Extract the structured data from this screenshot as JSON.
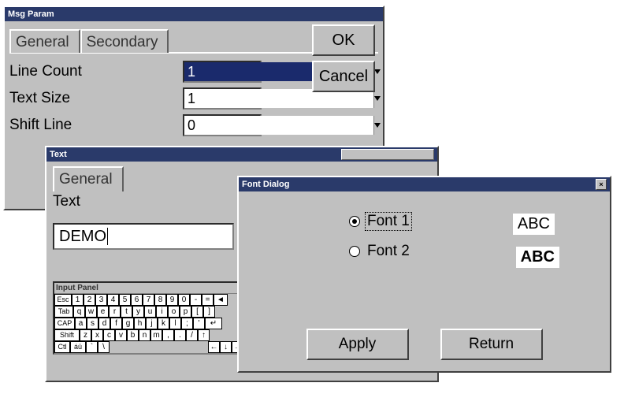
{
  "msgparam": {
    "title": "Msg Param",
    "tabs": {
      "general": "General",
      "secondary": "Secondary"
    },
    "fields": {
      "lineCount": {
        "label": "Line Count",
        "value": "1"
      },
      "textSize": {
        "label": "Text Size",
        "value": "1"
      },
      "shiftLine": {
        "label": "Shift Line",
        "value": "0"
      }
    },
    "buttons": {
      "ok": "OK",
      "cancel": "Cancel"
    }
  },
  "textwin": {
    "title": "Text",
    "tab_general": "General",
    "text_label": "Text",
    "text_value": "DEMO",
    "input_panel_title": "Input Panel",
    "keyboard": {
      "row1": [
        "Esc",
        "1",
        "2",
        "3",
        "4",
        "5",
        "6",
        "7",
        "8",
        "9",
        "0",
        "-",
        "=",
        "◄"
      ],
      "row2": [
        "Tab",
        "q",
        "w",
        "e",
        "r",
        "t",
        "y",
        "u",
        "i",
        "o",
        "p",
        "[",
        "]"
      ],
      "row3": [
        "CAP",
        "a",
        "s",
        "d",
        "f",
        "g",
        "h",
        "j",
        "k",
        "l",
        ";",
        "'"
      ],
      "row4": [
        "Shift",
        "z",
        "x",
        "c",
        "v",
        "b",
        "n",
        "m",
        ",",
        ".",
        "/"
      ],
      "row5": [
        "Ctl",
        "áü",
        "`",
        "\\"
      ],
      "enter": "↵",
      "arrows": {
        "up": "↑",
        "down": "↓",
        "left": "←",
        "right": "→"
      }
    }
  },
  "fontdlg": {
    "title": "Font Dialog",
    "font1_label": "Font 1",
    "font2_label": "Font 2",
    "sample1": "ABC",
    "sample2": "ABC",
    "selected": "font1",
    "apply": "Apply",
    "return": "Return",
    "close": "×"
  }
}
